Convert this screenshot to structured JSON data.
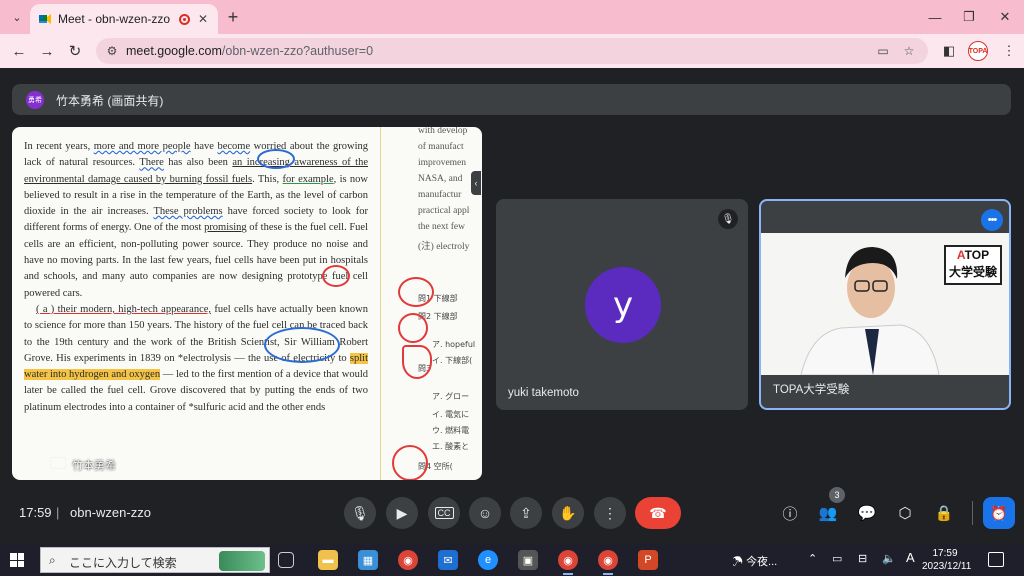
{
  "browser": {
    "tab_title": "Meet - obn-wzen-zzo",
    "tab_close": "✕",
    "new_tab": "+",
    "url_host": "meet.google.com",
    "url_path": "/obn-wzen-zzo?authuser=0",
    "window_controls": [
      "—",
      "❐",
      "✕"
    ],
    "profile_label": "TOPA"
  },
  "presenter": {
    "avatar_text": "勇希",
    "label": "竹本勇希 (画面共有)"
  },
  "document": {
    "paragraph1": [
      {
        "t": "In recent years, "
      },
      {
        "t": "more and more people",
        "c": "ul-b"
      },
      {
        "t": " have "
      },
      {
        "t": "become",
        "c": "ul-b"
      },
      {
        "t": " worried about the growing lack of natural resources. "
      },
      {
        "t": "There",
        "c": "ul-b"
      },
      {
        "t": " has also been "
      },
      {
        "t": "an increasing awareness of the environmental damage caused by burning fossil fuels",
        "c": "ul-k"
      },
      {
        "t": ". This, "
      },
      {
        "t": "for example",
        "c": "ul-g"
      },
      {
        "t": ", is now believed to result in a rise in the temperature of the Earth, as the level of carbon dioxide in the air increases. "
      },
      {
        "t": "These problems",
        "c": "ul-b"
      },
      {
        "t": " have forced society to look for different forms of energy. One of the most "
      },
      {
        "t": "promising",
        "c": "ul-k"
      },
      {
        "t": " of these is the fuel cell. Fuel cells are an efficient, non-polluting power source. They produce no noise and have no moving parts. In the last few years, fuel cells have been put in hospitals and schools, and many auto companies are now designing prototype fuel cell powered cars."
      }
    ],
    "paragraph2": [
      {
        "t": "( a ) their modern, high-tech appearance,",
        "c": "ul-r"
      },
      {
        "t": " fuel cells have actually been known to science for more than 150 years. The history of the fuel cell can be traced back to the 19th century and the work of the British Scientist, Sir William Robert Grove. His experiments in 1839 on *electrolysis — the use of electricity to "
      },
      {
        "t": "split water into hydrogen and oxygen",
        "c": "hl"
      },
      {
        "t": " — led to the first mention of a device that would later be called the fuel cell. Grove discovered that by putting the ends of two platinum electrodes into a container of *sulfuric acid and the other ends"
      }
    ],
    "right_lines": [
      "with develop",
      "of manufact",
      "improvemen",
      "NASA, and",
      "manufactur",
      "practical appl",
      "the next few",
      "(注) electroly"
    ],
    "questions": [
      "問1 下線部",
      "問2 下線部",
      "ア. hopeful",
      "イ. 下線部(",
      "問3 ",
      "ア. グロー",
      "イ. 電気に",
      "ウ. 燃料電",
      "エ. 酸素と",
      "問4 空所("
    ],
    "overlay_name": "竹本勇希"
  },
  "participants": [
    {
      "name": "yuki takemoto",
      "initial": "y",
      "muted": true
    },
    {
      "name": "TOPA大学受験",
      "sign_line1_red": "A",
      "sign_line1": "TOP",
      "sign_line2": "大学受験"
    }
  ],
  "meeting_bar": {
    "time": "17:59",
    "separator": "|",
    "code": "obn-wzen-zzo",
    "participant_count": "3"
  },
  "taskbar": {
    "search_placeholder": "ここに入力して検索",
    "weather": "今夜...",
    "ime": "A",
    "time": "17:59",
    "date": "2023/12/11"
  },
  "colors": {
    "meet_bg": "#202124",
    "hangup": "#ea4335",
    "active": "#1a73e8",
    "tab_strip": "#f7bccd"
  }
}
